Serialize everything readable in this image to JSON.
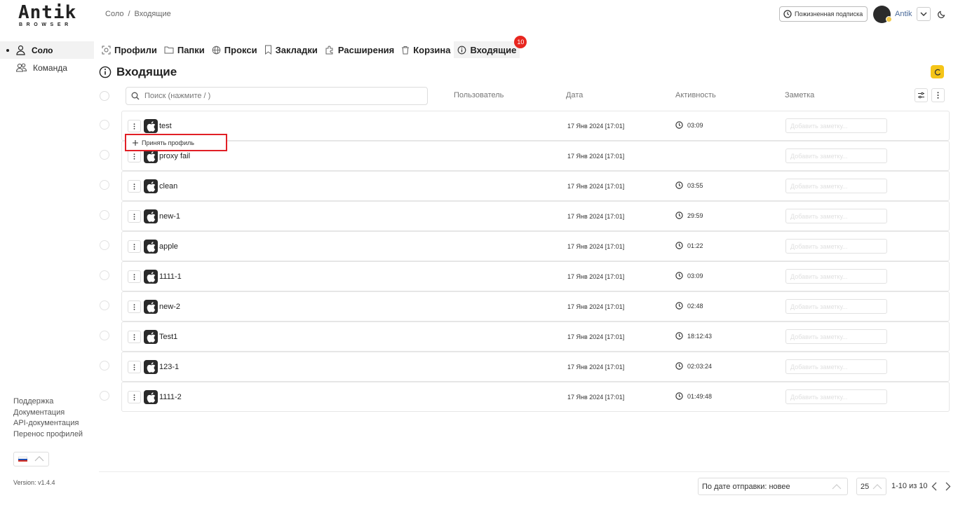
{
  "app": {
    "logo_main": "Antik",
    "logo_sub": "BROWSER"
  },
  "header": {
    "breadcrumb": [
      "Соло",
      "Входящие"
    ],
    "subscription_label": "Пожизненная подписка",
    "username": "Antik"
  },
  "sidebar": {
    "items": [
      {
        "label": "Соло",
        "icon": "user-icon",
        "active": true
      },
      {
        "label": "Команда",
        "icon": "team-icon",
        "active": false
      }
    ],
    "links": [
      "Поддержка",
      "Документация",
      "API-документация",
      "Перенос профилей"
    ],
    "version": "Version: v1.4.4"
  },
  "tabs": [
    {
      "label": "Профили",
      "icon": "profiles-icon"
    },
    {
      "label": "Папки",
      "icon": "folder-icon"
    },
    {
      "label": "Прокси",
      "icon": "globe-icon"
    },
    {
      "label": "Закладки",
      "icon": "bookmark-icon"
    },
    {
      "label": "Расширения",
      "icon": "puzzle-icon"
    },
    {
      "label": "Корзина",
      "icon": "trash-icon"
    },
    {
      "label": "Входящие",
      "icon": "info-icon",
      "active": true,
      "badge": "10"
    }
  ],
  "page": {
    "title": "Входящие"
  },
  "table": {
    "search_placeholder": "Поиск (нажмите / )",
    "columns": {
      "user": "Пользователь",
      "date": "Дата",
      "activity": "Активность",
      "note": "Заметка"
    },
    "note_placeholder": "Добавить заметку...",
    "rows": [
      {
        "name": "test",
        "date": "17 Янв 2024 [17:01]",
        "activity": "03:09"
      },
      {
        "name": "proxy fail",
        "date": "17 Янв 2024 [17:01]",
        "activity": ""
      },
      {
        "name": "clean",
        "date": "17 Янв 2024 [17:01]",
        "activity": "03:55"
      },
      {
        "name": "new-1",
        "date": "17 Янв 2024 [17:01]",
        "activity": "29:59"
      },
      {
        "name": "apple",
        "date": "17 Янв 2024 [17:01]",
        "activity": "01:22"
      },
      {
        "name": "1111-1",
        "date": "17 Янв 2024 [17:01]",
        "activity": "03:09"
      },
      {
        "name": "new-2",
        "date": "17 Янв 2024 [17:01]",
        "activity": "02:48"
      },
      {
        "name": "Test1",
        "date": "17 Янв 2024 [17:01]",
        "activity": "18:12:43"
      },
      {
        "name": "123-1",
        "date": "17 Янв 2024 [17:01]",
        "activity": "02:03:24"
      },
      {
        "name": "1111-2",
        "date": "17 Янв 2024 [17:01]",
        "activity": "01:49:48"
      }
    ]
  },
  "context_menu": {
    "accept_label": "Принять профиль"
  },
  "footer": {
    "sort_value": "По дате отправки: новее",
    "page_size": "25",
    "page_range": "1-10 из 10"
  },
  "colors": {
    "accent_yellow": "#f5c518",
    "badge_red": "#e8261f",
    "highlight_red": "#e11f26"
  }
}
